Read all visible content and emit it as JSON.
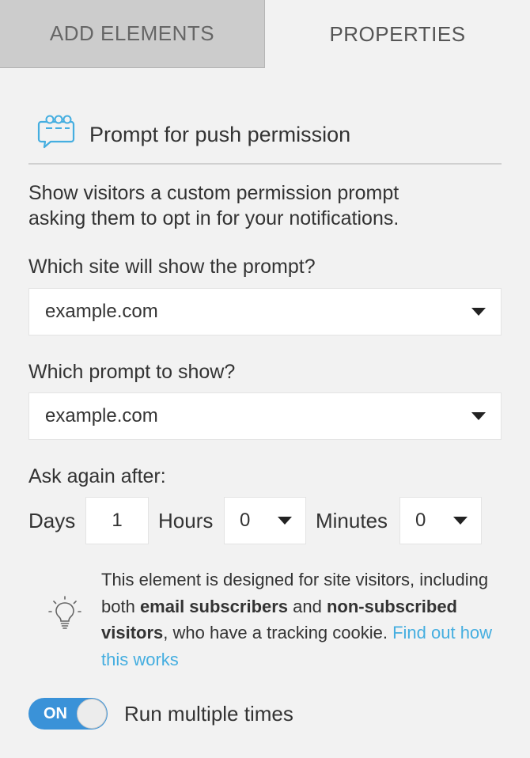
{
  "tabs": {
    "add_elements": "ADD ELEMENTS",
    "properties": "PROPERTIES"
  },
  "header": {
    "icon": "chat-bubble-icon",
    "title": "Prompt for push permission"
  },
  "description": {
    "line1": "Show visitors a custom permission prompt",
    "line2": "asking them to opt in for your notifications."
  },
  "site_field": {
    "label": "Which site will show the prompt?",
    "value": "example.com"
  },
  "prompt_field": {
    "label": "Which prompt to show?",
    "value": "example.com"
  },
  "ask_again": {
    "label": "Ask again after:",
    "days_label": "Days",
    "days_value": "1",
    "hours_label": "Hours",
    "hours_value": "0",
    "minutes_label": "Minutes",
    "minutes_value": "0"
  },
  "info": {
    "icon": "lightbulb-icon",
    "text1": "This element is designed for site visitors, including both ",
    "bold1": "email subscribers",
    "text2": " and ",
    "bold2": "non-subscribed visitors",
    "text3": ", who have a tracking cookie. ",
    "link": "Find out how this works"
  },
  "toggle": {
    "state_label": "ON",
    "label": "Run multiple times"
  },
  "colors": {
    "accent": "#3a92d8",
    "link": "#45aee0",
    "background": "#f2f2f2",
    "inactive_tab": "#cccccc"
  }
}
